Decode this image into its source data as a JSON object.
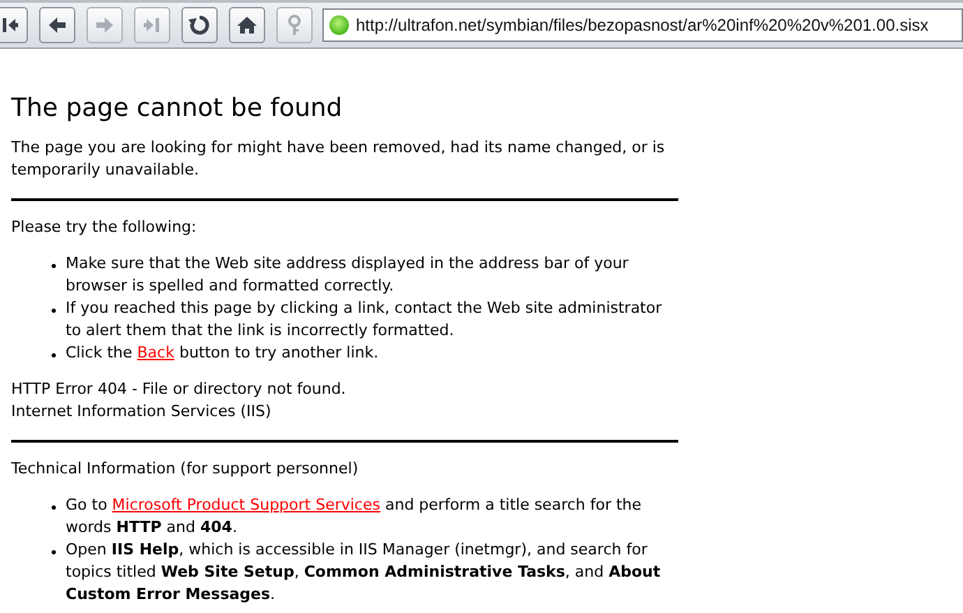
{
  "toolbar": {
    "buttons": [
      {
        "kind": "first",
        "disabled": false
      },
      {
        "kind": "back",
        "disabled": false
      },
      {
        "kind": "forward",
        "disabled": true
      },
      {
        "kind": "last",
        "disabled": true
      },
      {
        "kind": "reload",
        "disabled": false
      },
      {
        "kind": "home",
        "disabled": false
      },
      {
        "kind": "key",
        "disabled": true
      }
    ],
    "address": {
      "value": "http://ultrafon.net/symbian/files/bezopasnost/ar%20inf%20%20v%201.00.sisx"
    }
  },
  "page": {
    "title": "The page cannot be found",
    "intro": "The page you are looking for might have been removed, had its name changed, or is temporarily unavailable.",
    "try_heading": "Please try the following:",
    "try_items": [
      [
        {
          "kind": "text",
          "text": "Make sure that the Web site address displayed in the address bar of your browser is spelled and formatted correctly."
        }
      ],
      [
        {
          "kind": "text",
          "text": "If you reached this page by clicking a link, contact the Web site administrator to alert them that the link is incorrectly formatted."
        }
      ],
      [
        {
          "kind": "text",
          "text": "Click the "
        },
        {
          "kind": "link",
          "text": "Back"
        },
        {
          "kind": "text",
          "text": " button to try another link."
        }
      ]
    ],
    "error_lines": [
      "HTTP Error 404 - File or directory not found.",
      "Internet Information Services (IIS)"
    ],
    "tech_heading": "Technical Information (for support personnel)",
    "tech_items": [
      [
        {
          "kind": "text",
          "text": "Go to "
        },
        {
          "kind": "link",
          "text": "Microsoft Product Support Services"
        },
        {
          "kind": "text",
          "text": " and perform a title search for the words **HTTP** and **404**."
        }
      ],
      [
        {
          "kind": "text",
          "text": "Open **IIS Help**, which is accessible in IIS Manager (inetmgr), and search for topics titled **Web Site Setup**, **Common Administrative Tasks**, and **About Custom Error Messages**."
        }
      ]
    ]
  }
}
